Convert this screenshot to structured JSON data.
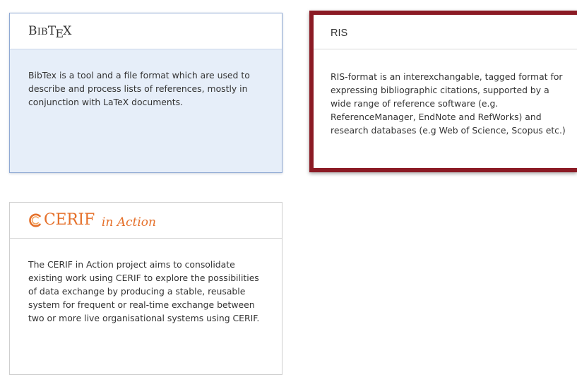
{
  "cards": {
    "bibtex": {
      "title_parts": {
        "b": "B",
        "ib": "IB",
        "t": "T",
        "e": "E",
        "x": "X"
      },
      "description": "BibTex is a tool and a file format which are used to describe and process lists of references, mostly in conjunction with LaTeX documents.",
      "state": "hover"
    },
    "ris": {
      "title": "RIS",
      "description": "RIS-format is an interexchangable, tagged format for expressing bibliographic citations, supported by a wide range of reference software (e.g. ReferenceManager, EndNote and RefWorks) and research databases (e.g Web of Science, Scopus etc.)",
      "state": "selected"
    },
    "cerif": {
      "logo_word": "CERIF",
      "logo_script": "in Action",
      "description": "The CERIF in Action project aims to consolidate existing work using CERIF to explore the possibilities of data exchange by producing a stable, reusable system for frequent or real-time exchange between two or more live organisational systems using CERIF.",
      "state": "default"
    }
  },
  "colors": {
    "selected_border": "#8b1a24",
    "hover_background": "#e6eef9",
    "hover_border": "#8fa9d3",
    "cerif_orange": "#e5702a",
    "body_text": "#333333"
  },
  "icons": {
    "bibtex": "bibtex-logo",
    "cerif": "cerif-c-swirl-icon"
  }
}
